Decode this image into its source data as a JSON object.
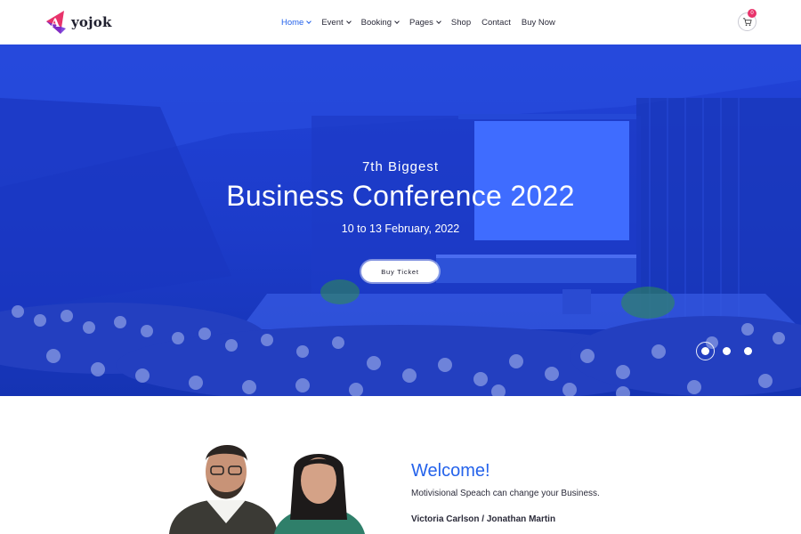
{
  "brand": {
    "logo_letter": "A",
    "name": "yojok"
  },
  "nav": {
    "items": [
      {
        "label": "Home",
        "active": true,
        "dropdown": true
      },
      {
        "label": "Event",
        "active": false,
        "dropdown": true
      },
      {
        "label": "Booking",
        "active": false,
        "dropdown": true
      },
      {
        "label": "Pages",
        "active": false,
        "dropdown": true
      },
      {
        "label": "Shop",
        "active": false,
        "dropdown": false
      },
      {
        "label": "Contact",
        "active": false,
        "dropdown": false
      },
      {
        "label": "Buy Now",
        "active": false,
        "dropdown": false
      }
    ]
  },
  "cart": {
    "icon": "cart-icon",
    "count": "0"
  },
  "hero": {
    "subtitle": "7th Biggest",
    "title": "Business Conference 2022",
    "date": "10 to 13 February, 2022",
    "button_label": "Buy Ticket",
    "slides": 3,
    "active_slide": 1
  },
  "welcome": {
    "title": "Welcome!",
    "text": "Motivisional Speach can change your Business.",
    "names": "Victoria Carlson / Jonathan Martin"
  },
  "colors": {
    "accent": "#2563eb",
    "hero_overlay": "#1f3fd6",
    "brand_pink": "#e8336b",
    "brand_purple": "#6b2bd6"
  }
}
